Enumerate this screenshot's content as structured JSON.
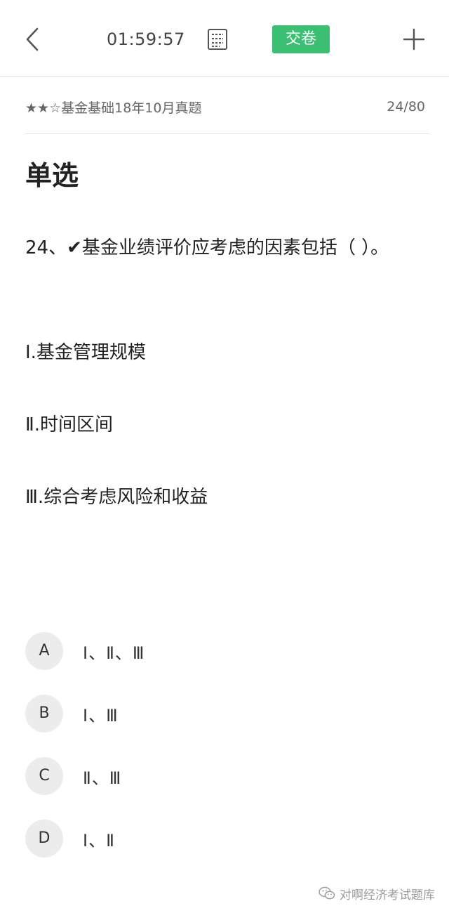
{
  "toolbar": {
    "timer": "01:59:57",
    "submit_label": "交卷",
    "accent_color": "#3bbf73",
    "icons": {
      "back": "chevron-left-icon",
      "sheet": "answer-sheet-icon",
      "add": "plus-icon"
    }
  },
  "subheader": {
    "paper_title": "★★☆基金基础18年10月真题",
    "progress": "24/80"
  },
  "question": {
    "type_label": "单选",
    "text": "24、✔基金业绩评价应考虑的因素包括（ ）。",
    "statements": [
      "Ⅰ.基金管理规模",
      "Ⅱ.时间区间",
      "Ⅲ.综合考虑风险和收益"
    ],
    "options": [
      {
        "letter": "A",
        "text": "Ⅰ、Ⅱ、Ⅲ"
      },
      {
        "letter": "B",
        "text": "Ⅰ、Ⅲ"
      },
      {
        "letter": "C",
        "text": "Ⅱ、Ⅲ"
      },
      {
        "letter": "D",
        "text": "Ⅰ、Ⅱ"
      }
    ]
  },
  "watermark": {
    "text": "对啊经济考试题库",
    "icon": "wechat-icon"
  }
}
